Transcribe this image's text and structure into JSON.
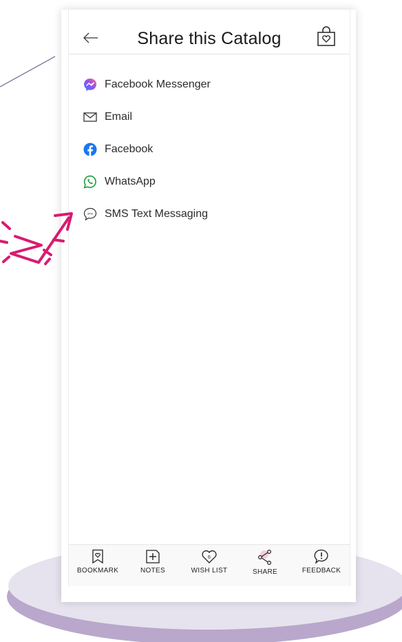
{
  "header": {
    "title": "Share this Catalog"
  },
  "share_options": [
    {
      "label": "Facebook Messenger",
      "icon": "messenger-icon",
      "color": "#7b5cf0"
    },
    {
      "label": "Email",
      "icon": "email-icon",
      "color": "#333333"
    },
    {
      "label": "Facebook",
      "icon": "facebook-icon",
      "color": "#1877f2"
    },
    {
      "label": "WhatsApp",
      "icon": "whatsapp-icon",
      "color": "#25a244"
    },
    {
      "label": "SMS Text Messaging",
      "icon": "sms-icon",
      "color": "#333333",
      "icon_text": "sms"
    }
  ],
  "tabbar": {
    "bookmark": "BOOKMARK",
    "notes": "NOTES",
    "wishlist": "WISH LIST",
    "wishlist_count": "6",
    "share": "SHARE",
    "feedback": "FEEDBACK"
  },
  "colors": {
    "accent": "#d81b72",
    "pedestal": "#b9a7cc",
    "pedestal_top": "#e6e3ee"
  }
}
